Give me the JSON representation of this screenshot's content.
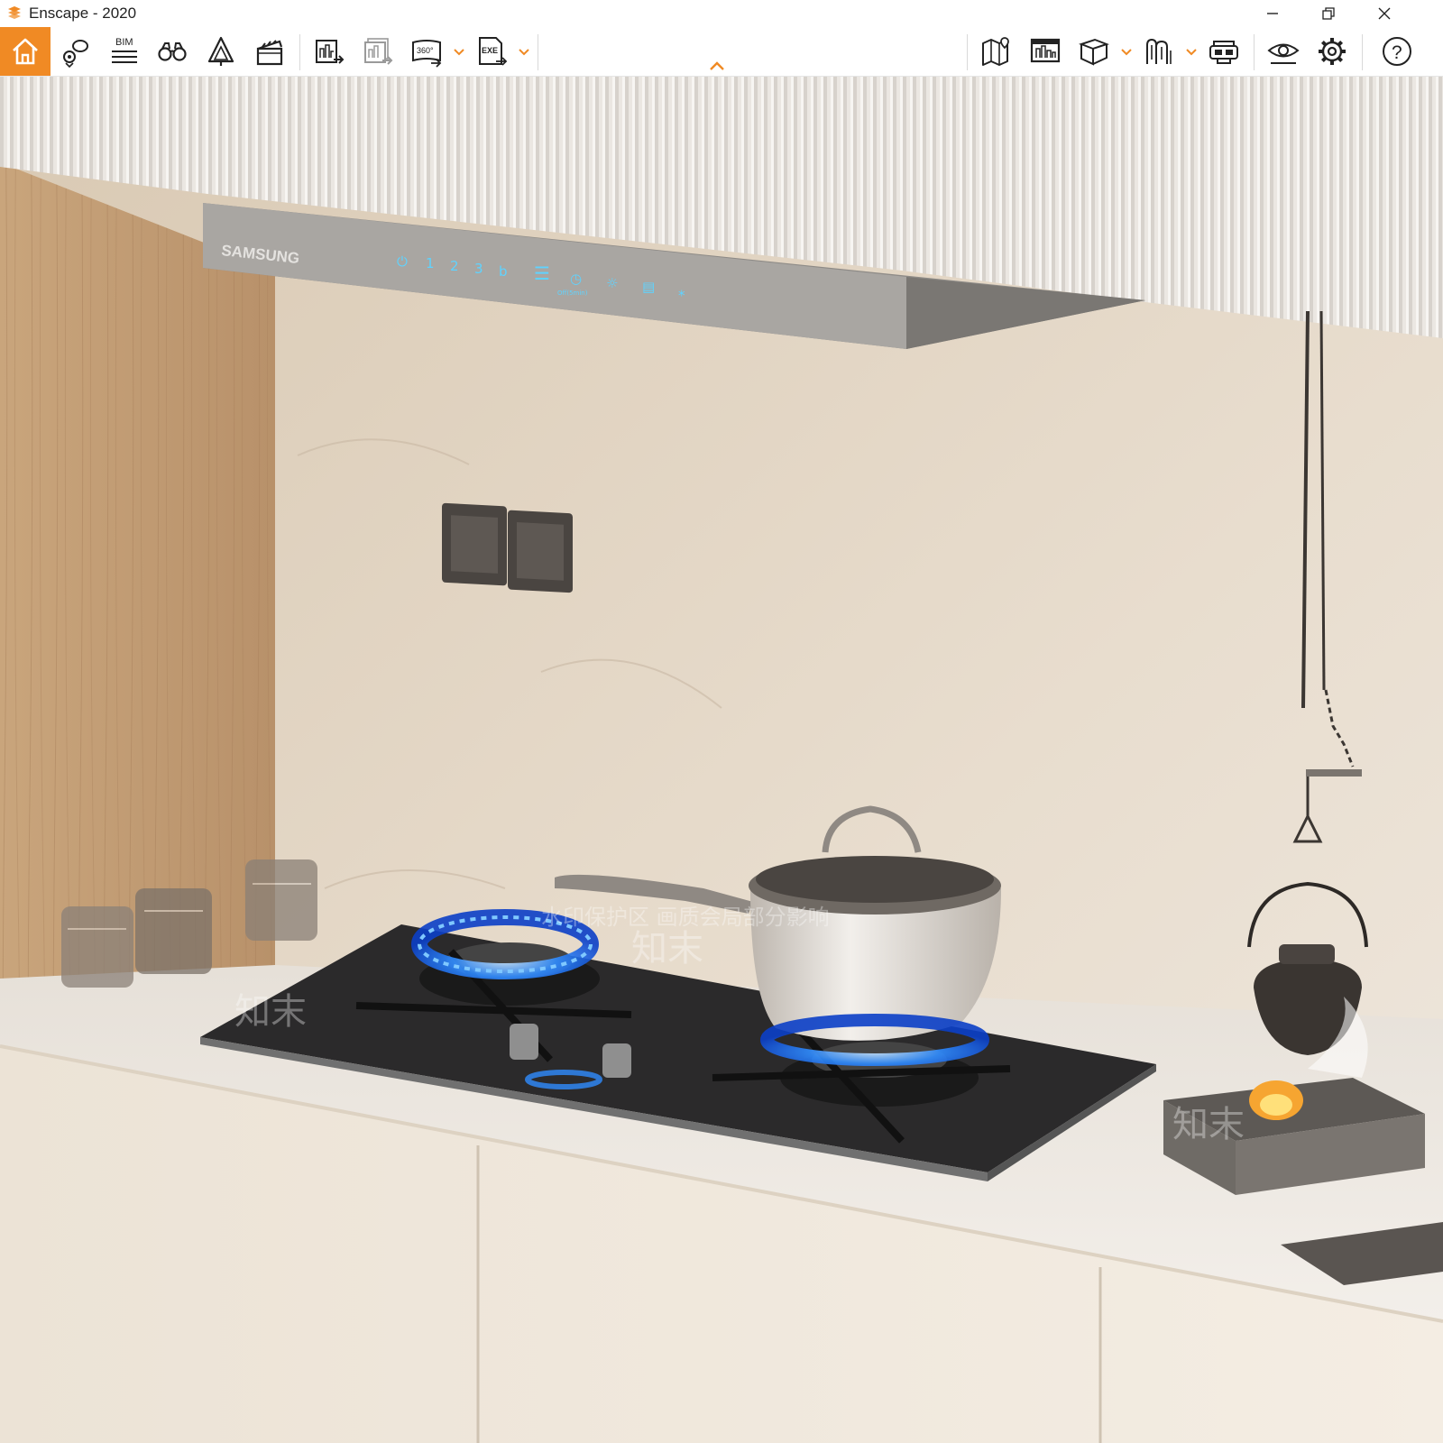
{
  "window": {
    "title": "Enscape - 2020",
    "minimize": "—",
    "restore": "❐",
    "close": "✕"
  },
  "toolbar": {
    "bim_label": "BIM",
    "pano_label": "360°",
    "exe_label": "EXE",
    "help_label": "?",
    "accent": "#f08a24",
    "icons": [
      "home-icon",
      "views-icon",
      "bim-icon",
      "binoculars-icon",
      "tree-icon",
      "clapper-icon",
      "screenshot-export-icon",
      "batch-export-icon",
      "panorama-icon",
      "exe-export-icon",
      "map-icon",
      "visual-settings-icon",
      "asset-box-icon",
      "asset-library-icon",
      "vr-headset-icon",
      "view-eye-icon",
      "settings-gear-icon",
      "help-icon"
    ]
  },
  "scene": {
    "hood_brand": "SAMSUNG",
    "hood_buttons": [
      "⏻",
      "1",
      "2",
      "3",
      "b",
      "☰",
      "◷",
      "☼",
      "▤",
      "⁎"
    ],
    "hood_timer_label": "Off(5min)",
    "watermark_notice": "水印保护区   画质会局部分影响",
    "watermark_brand": "知末"
  }
}
